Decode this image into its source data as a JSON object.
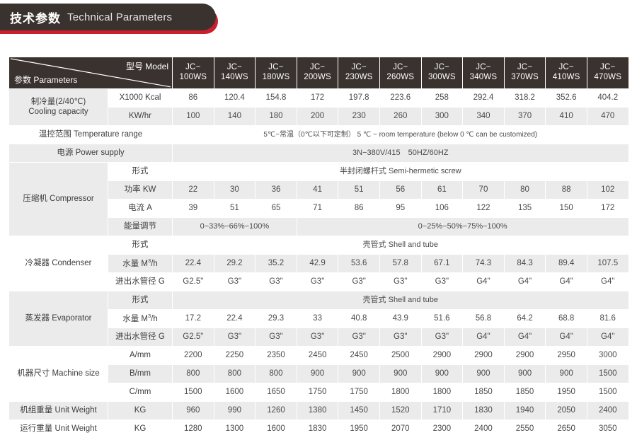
{
  "banner": {
    "title_cn": "技术参数",
    "title_en": "Technical Parameters",
    "bar_color": "#3a322f",
    "accent_color": "#c8202c"
  },
  "table": {
    "corner": {
      "model_label": "型号 Model",
      "parameters_label": "参数 Parameters"
    },
    "models": [
      "JC−\n100WS",
      "JC−\n140WS",
      "JC−\n180WS",
      "JC−\n200WS",
      "JC−\n230WS",
      "JC−\n260WS",
      "JC−\n300WS",
      "JC−\n340WS",
      "JC−\n370WS",
      "JC−\n410WS",
      "JC−\n470WS"
    ],
    "model_lines": [
      [
        "JC−",
        "100WS"
      ],
      [
        "JC−",
        "140WS"
      ],
      [
        "JC−",
        "180WS"
      ],
      [
        "JC−",
        "200WS"
      ],
      [
        "JC−",
        "230WS"
      ],
      [
        "JC−",
        "260WS"
      ],
      [
        "JC−",
        "300WS"
      ],
      [
        "JC−",
        "340WS"
      ],
      [
        "JC−",
        "370WS"
      ],
      [
        "JC−",
        "410WS"
      ],
      [
        "JC−",
        "470WS"
      ]
    ],
    "groups": {
      "cooling": "制冷量(2/40℃)\nCooling capacity",
      "cooling_cn": "制冷量(2/40℃)",
      "cooling_en": "Cooling capacity",
      "compressor": "压缩机 Compressor",
      "condenser": "冷凝器 Condenser",
      "evaporator": "蒸发器 Evaporator",
      "machine_size": "机器尺寸 Machine size"
    },
    "sub_labels": {
      "kcal": "X1000 Kcal",
      "kwhr": "KW/hr",
      "temp_range": "温控范围 Temperature range",
      "power_supply": "电源 Power supply",
      "form": "形式",
      "power_kw": "功率 KW",
      "current_a": "电流 A",
      "energy_adj": "能量调节",
      "water_flow": "水量 M",
      "water_flow_sup": "3",
      "water_flow_tail": "/h",
      "pipe_dia": "进出水管径 G",
      "a_mm": "A/mm",
      "b_mm": "B/mm",
      "c_mm": "C/mm",
      "unit_weight_label": "机组重量 Unit Weight",
      "running_weight_label": "运行重量 Unit Weight",
      "kg": "KG"
    },
    "merged_values": {
      "temp_range": "5℃−常温（0℃以下可定制） 5 ℃ − room temperature (below 0 ℃ can be customized)",
      "power_supply": "3N−380V/415　50HZ/60HZ",
      "compressor_form": "半封闭螺杆式 Semi-hermetic screw",
      "energy_adj_left": "0−33%−66%−100%",
      "energy_adj_right": "0−25%−50%−75%−100%",
      "condenser_form": "壳管式 Shell and tube",
      "evaporator_form": "壳管式 Shell and tube"
    },
    "rows": {
      "kcal": [
        "86",
        "120.4",
        "154.8",
        "172",
        "197.8",
        "223.6",
        "258",
        "292.4",
        "318.2",
        "352.6",
        "404.2"
      ],
      "kwhr": [
        "100",
        "140",
        "180",
        "200",
        "230",
        "260",
        "300",
        "340",
        "370",
        "410",
        "470"
      ],
      "power_kw": [
        "22",
        "30",
        "36",
        "41",
        "51",
        "56",
        "61",
        "70",
        "80",
        "88",
        "102"
      ],
      "current_a": [
        "39",
        "51",
        "65",
        "71",
        "86",
        "95",
        "106",
        "122",
        "135",
        "150",
        "172"
      ],
      "cond_water": [
        "22.4",
        "29.2",
        "35.2",
        "42.9",
        "53.6",
        "57.8",
        "67.1",
        "74.3",
        "84.3",
        "89.4",
        "107.5"
      ],
      "cond_pipe": [
        "G2.5\"",
        "G3\"",
        "G3\"",
        "G3\"",
        "G3\"",
        "G3\"",
        "G3\"",
        "G4\"",
        "G4\"",
        "G4\"",
        "G4\""
      ],
      "evap_water": [
        "17.2",
        "22.4",
        "29.3",
        "33",
        "40.8",
        "43.9",
        "51.6",
        "56.8",
        "64.2",
        "68.8",
        "81.6"
      ],
      "evap_pipe": [
        "G2.5\"",
        "G3\"",
        "G3\"",
        "G3\"",
        "G3\"",
        "G3\"",
        "G3\"",
        "G4\"",
        "G4\"",
        "G4\"",
        "G4\""
      ],
      "size_a": [
        "2200",
        "2250",
        "2350",
        "2450",
        "2450",
        "2500",
        "2900",
        "2900",
        "2900",
        "2950",
        "3000"
      ],
      "size_b": [
        "800",
        "800",
        "800",
        "900",
        "900",
        "900",
        "900",
        "900",
        "900",
        "900",
        "1500"
      ],
      "size_c": [
        "1500",
        "1600",
        "1650",
        "1750",
        "1750",
        "1800",
        "1800",
        "1850",
        "1850",
        "1950",
        "1500"
      ],
      "unit_weight": [
        "960",
        "990",
        "1260",
        "1380",
        "1450",
        "1520",
        "1710",
        "1830",
        "1940",
        "2050",
        "2400"
      ],
      "run_weight": [
        "1280",
        "1300",
        "1600",
        "1830",
        "1950",
        "2070",
        "2300",
        "2400",
        "2550",
        "2650",
        "3050"
      ]
    }
  }
}
